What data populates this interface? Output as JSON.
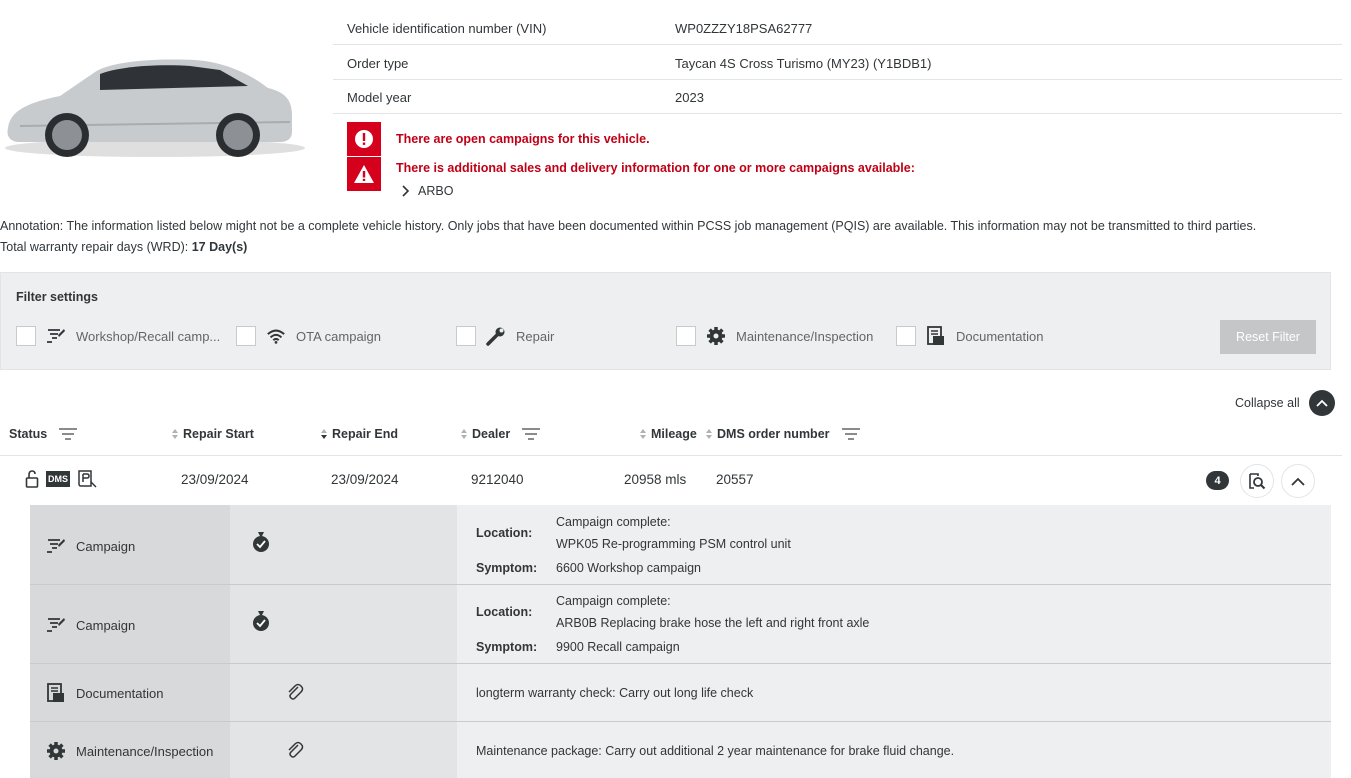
{
  "vehicle": {
    "rows": [
      {
        "label": "Vehicle identification number (VIN)",
        "value": "WP0ZZZY18PSA62777"
      },
      {
        "label": "Order type",
        "value": "Taycan 4S Cross Turismo (MY23) (Y1BDB1)"
      },
      {
        "label": "Model year",
        "value": "2023"
      }
    ]
  },
  "alerts": {
    "open_campaigns": "There are open campaigns for this vehicle.",
    "additional_info": "There is additional sales and delivery information for one or more campaigns available:",
    "arbo_link": "ARBO"
  },
  "annotation": "Annotation: The information listed below might not be a complete vehicle history. Only jobs that have been documented within PCSS job management (PQIS) are available. This information may not be transmitted to third parties.",
  "wrd": {
    "label": "Total warranty repair days (WRD): ",
    "value": "17 Day(s)"
  },
  "filter": {
    "title": "Filter settings",
    "items": [
      {
        "label": "Workshop/Recall camp...",
        "icon": "campaign-icon"
      },
      {
        "label": "OTA campaign",
        "icon": "wifi-icon"
      },
      {
        "label": "Repair",
        "icon": "wrench-icon"
      },
      {
        "label": "Maintenance/Inspection",
        "icon": "gear-icon"
      },
      {
        "label": "Documentation",
        "icon": "document-icon"
      }
    ],
    "reset_label": "Reset Filter"
  },
  "collapse_label": "Collapse all",
  "table": {
    "headers": {
      "status": "Status",
      "repair_start": "Repair Start",
      "repair_end": "Repair End",
      "dealer": "Dealer",
      "mileage": "Mileage",
      "dms": "DMS order number"
    },
    "row": {
      "status_badge": "DMS",
      "repair_start": "23/09/2024",
      "repair_end": "23/09/2024",
      "dealer": "9212040",
      "mileage": "20958 mls",
      "dms": "20557",
      "count": "4"
    },
    "details": [
      {
        "type": "Campaign",
        "location_label": "Location:",
        "status": "Campaign complete:",
        "location": "WPK05 Re-programming PSM control unit",
        "symptom_label": "Symptom:",
        "symptom": "6600 Workshop campaign"
      },
      {
        "type": "Campaign",
        "location_label": "Location:",
        "status": "Campaign complete:",
        "location": "ARB0B Replacing brake hose the left and right front axle",
        "symptom_label": "Symptom:",
        "symptom": "9900 Recall campaign"
      },
      {
        "type": "Documentation",
        "description": "longterm warranty check: Carry out long life check"
      },
      {
        "type": "Maintenance/Inspection",
        "description": "Maintenance package: Carry out additional 2 year maintenance for brake fluid change."
      }
    ]
  },
  "colors": {
    "alert_red": "#d5001c",
    "text": "#313639",
    "panel": "#eeeff0"
  }
}
